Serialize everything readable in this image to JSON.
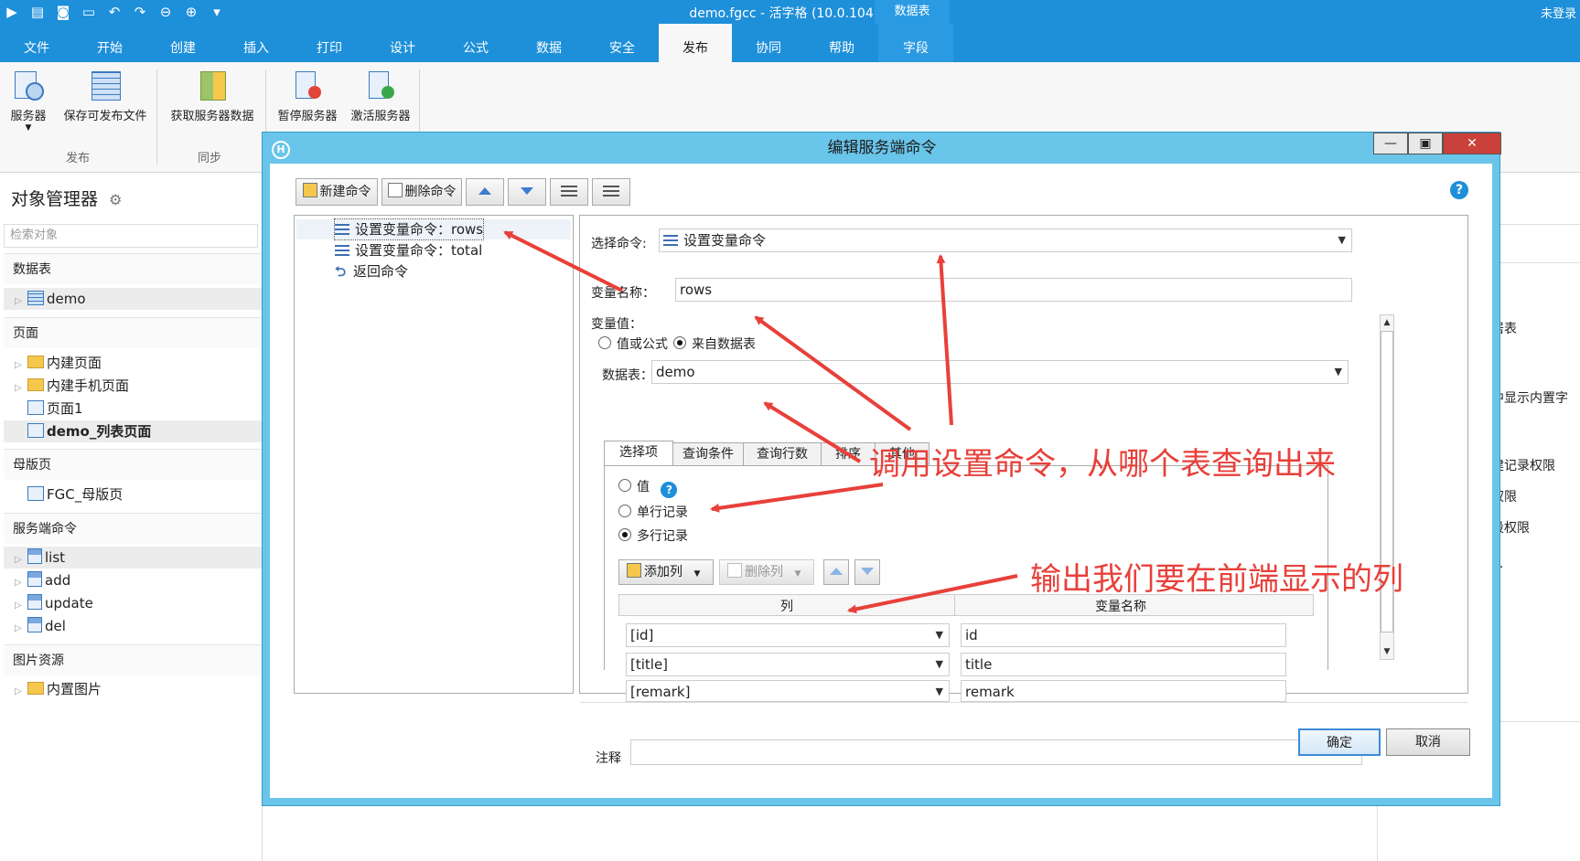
{
  "window": {
    "title": "demo.fgcc - 活字格 (10.0.104.0)",
    "context_group": "数据表",
    "login": "未登录"
  },
  "qat_icons": [
    "run-icon",
    "new-file-icon",
    "save-icon",
    "open-icon",
    "undo-icon",
    "redo-icon",
    "back-icon",
    "forward-icon",
    "customize-icon"
  ],
  "ribbon": {
    "tabs": [
      "文件",
      "开始",
      "创建",
      "插入",
      "打印",
      "设计",
      "公式",
      "数据",
      "安全",
      "发布",
      "协同",
      "帮助",
      "字段"
    ],
    "active_tab": "发布",
    "buttons": {
      "server": "服务器",
      "save_publish": "保存可发布文件",
      "get_server_data": "获取服务器数据",
      "pause_server": "暂停服务器",
      "activate_server": "激活服务器"
    },
    "groups": {
      "publish": "发布",
      "sync": "同步"
    }
  },
  "sidebar": {
    "title": "对象管理器",
    "search_placeholder": "检索对象",
    "sections": {
      "tables": "数据表",
      "pages": "页面",
      "master": "母版页",
      "server_cmds": "服务端命令",
      "images": "图片资源"
    },
    "items": {
      "demo": "demo",
      "builtin_pages": "内建页面",
      "builtin_mobile": "内建手机页面",
      "page1": "页面1",
      "demo_list": "demo_列表页面",
      "fgc_master": "FGC_母版页",
      "list": "list",
      "add": "add",
      "update": "update",
      "del": "del",
      "builtin_images": "内置图片"
    }
  },
  "right_pane": {
    "partial_1": "置",
    "partial_2": "居表",
    "partial_3": "中显示内置字",
    "partial_4": "建记录权限",
    "partial_5": "权限",
    "partial_6": "段权限",
    "partial_7": "..."
  },
  "dialog": {
    "title": "编辑服务端命令",
    "toolbar": {
      "new_cmd": "新建命令",
      "delete_cmd": "删除命令"
    },
    "commands": [
      {
        "label": "设置变量命令：rows"
      },
      {
        "label": "设置变量命令：total"
      },
      {
        "label": "返回命令"
      }
    ],
    "select_cmd_label": "选择命令:",
    "select_cmd_value": "设置变量命令",
    "var_name_label": "变量名称：",
    "var_name_value": "rows",
    "var_value_label": "变量值：",
    "value_mode": {
      "formula": "值或公式",
      "from_table": "来自数据表",
      "selected": "来自数据表"
    },
    "table_label": "数据表：",
    "table_value": "demo",
    "inner_tabs": [
      "选择项",
      "查询条件",
      "查询行数",
      "排序",
      "其他"
    ],
    "result_options": {
      "value": "值",
      "single_row": "单行记录",
      "multi_row": "多行记录",
      "selected": "多行记录"
    },
    "add_col": "添加列",
    "delete_col": "删除列",
    "grid_headers": {
      "column": "列",
      "var_name": "变量名称"
    },
    "grid_rows": [
      {
        "column": "[id]",
        "var_name": "id"
      },
      {
        "column": "[title]",
        "var_name": "title"
      },
      {
        "column": "[remark]",
        "var_name": "remark"
      }
    ],
    "note_label": "注释",
    "ok": "确定",
    "cancel": "取消"
  },
  "annotations": {
    "note1": "调用设置命令，从哪个表查询出来",
    "note2": "输出我们要在前端显示的列"
  },
  "colors": {
    "ribbon_blue": "#1e8fd9",
    "dialog_blue": "#69c5ea",
    "annotation_red": "#e8403a"
  }
}
